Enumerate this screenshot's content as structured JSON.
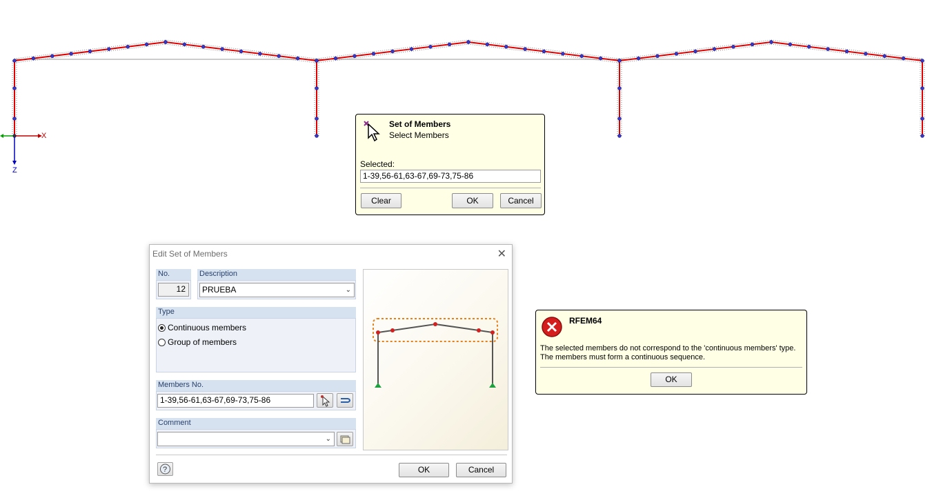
{
  "viewport": {
    "axis_x_label": "X",
    "axis_z_label": "Z"
  },
  "select_panel": {
    "title": "Set of Members",
    "subtitle": "Select Members",
    "selected_label": "Selected:",
    "selected_value": "1-39,56-61,63-67,69-73,75-86",
    "clear_label": "Clear",
    "ok_label": "OK",
    "cancel_label": "Cancel",
    "icon": "select-cursor-icon"
  },
  "edit_dialog": {
    "title": "Edit Set of Members",
    "no_label": "No.",
    "no_value": "12",
    "description_label": "Description",
    "description_value": "PRUEBA",
    "type_label": "Type",
    "type_options": [
      {
        "label": "Continuous members",
        "selected": true
      },
      {
        "label": "Group of members",
        "selected": false
      }
    ],
    "members_label": "Members No.",
    "members_value": "1-39,56-61,63-67,69-73,75-86",
    "comment_label": "Comment",
    "comment_value": "",
    "ok_label": "OK",
    "cancel_label": "Cancel"
  },
  "error_box": {
    "title": "RFEM64",
    "message": "The selected members do not correspond to the 'continuous members' type. The members must form a continuous sequence.",
    "ok_label": "OK",
    "icon": "error-icon"
  },
  "colors": {
    "member_red": "#e00000",
    "node_blue": "#3838c8",
    "panel_yellow": "#ffffe5",
    "group_header": "#d6e2f0"
  }
}
